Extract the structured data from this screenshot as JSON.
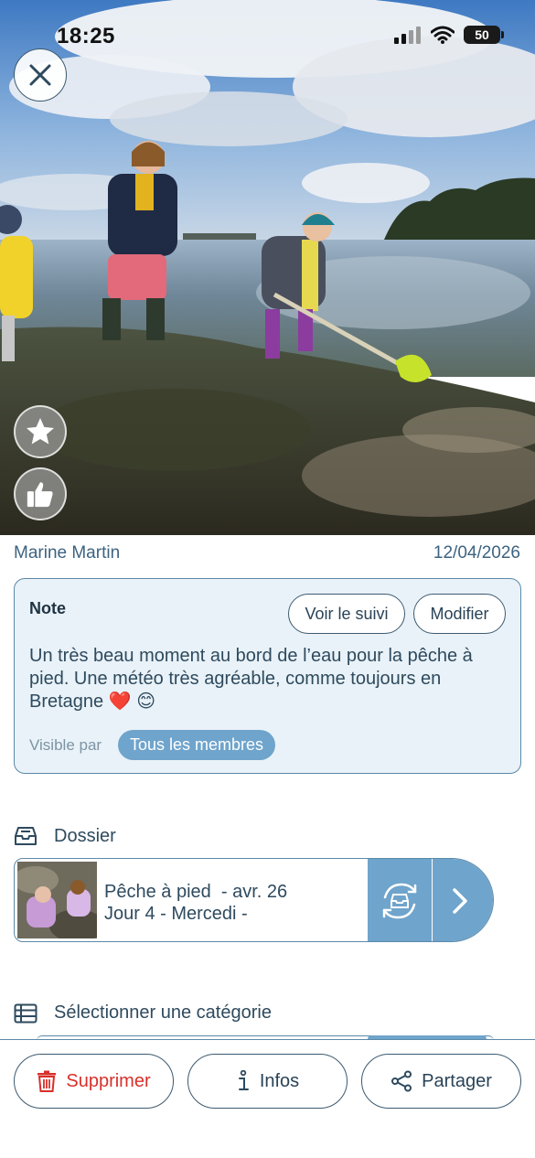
{
  "status_bar": {
    "time": "18:25",
    "battery": "50"
  },
  "photo": {
    "description_icon": "photo-beach-fishing"
  },
  "meta": {
    "author": "Marine Martin",
    "date": "12/04/2026"
  },
  "note": {
    "title": "Note",
    "follow_button": "Voir le suivi",
    "edit_button": "Modifier",
    "text": "Un très beau moment au bord de l’eau pour la pêche à pied. Une météo très agréable, comme toujours en Bretagne ❤️ 😊",
    "visibility_label": "Visible par",
    "visibility_value": "Tous les membres"
  },
  "dossier": {
    "section_label": "Dossier",
    "item_title": "Pêche à pied  - avr. 26",
    "item_subtitle": "Jour 4 - Mercedi -"
  },
  "category": {
    "section_label": "Sélectionner une catégorie"
  },
  "bottom_bar": {
    "delete_label": "Supprimer",
    "info_label": "Infos",
    "share_label": "Partager"
  },
  "colors": {
    "accent": "#6fa4cc",
    "border": "#5b89a8",
    "text": "#2e4a5e",
    "danger": "#d9302a",
    "note_bg": "#e9f2f8"
  }
}
